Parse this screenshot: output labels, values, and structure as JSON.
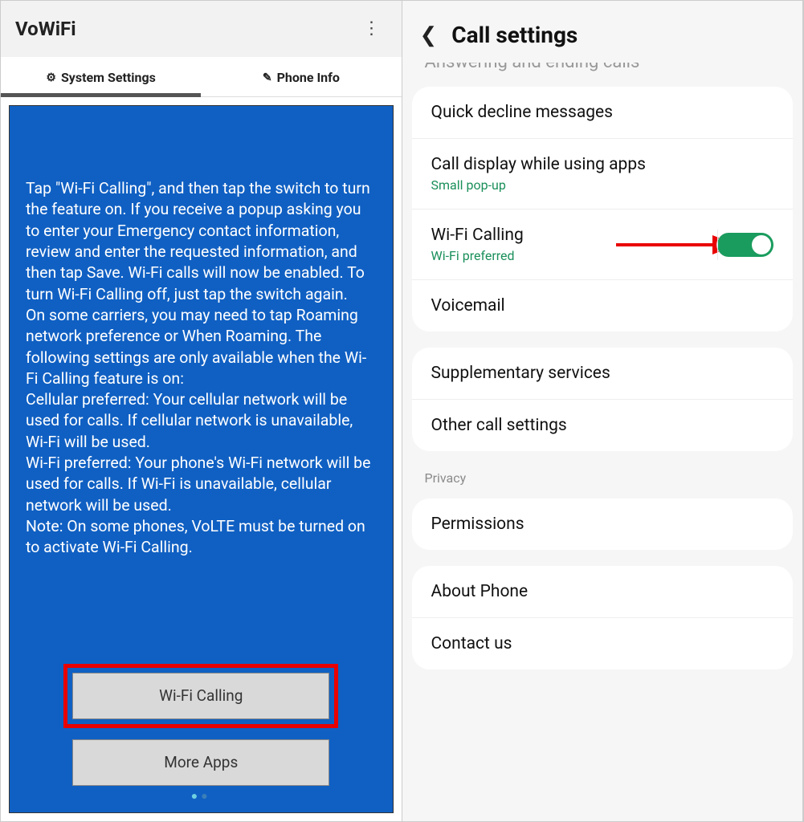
{
  "left": {
    "title": "VoWiFi",
    "tabs": {
      "system": "System Settings",
      "phone": "Phone Info"
    },
    "body": "Tap \"Wi-Fi Calling\", and then tap the switch to turn the feature on. If you receive a popup asking you to enter your Emergency contact information, review and enter the requested information, and then tap Save. Wi-Fi calls will now be enabled. To turn Wi-Fi Calling off, just tap the switch again.\nOn some carriers, you may need to tap Roaming network preference or When Roaming. The following settings are only available when the Wi-Fi Calling feature is on:\nCellular preferred: Your cellular network will be used for calls. If cellular network is unavailable, Wi-Fi will be used.\nWi-Fi preferred: Your phone's Wi-Fi network will be used for calls. If Wi-Fi is unavailable, cellular network will be used.\nNote: On some phones, VoLTE must be turned on to activate Wi-Fi Calling.",
    "buttons": {
      "wifi": "Wi-Fi Calling",
      "more": "More Apps"
    }
  },
  "right": {
    "title": "Call settings",
    "partial_row": "Answering and ending calls",
    "rows": {
      "quick_decline": "Quick decline messages",
      "call_display": "Call display while using apps",
      "call_display_sub": "Small pop-up",
      "wifi_calling": "Wi-Fi Calling",
      "wifi_calling_sub": "Wi-Fi preferred",
      "voicemail": "Voicemail",
      "supplementary": "Supplementary services",
      "other": "Other call settings",
      "privacy_label": "Privacy",
      "permissions": "Permissions",
      "about": "About Phone",
      "contact": "Contact us"
    }
  }
}
